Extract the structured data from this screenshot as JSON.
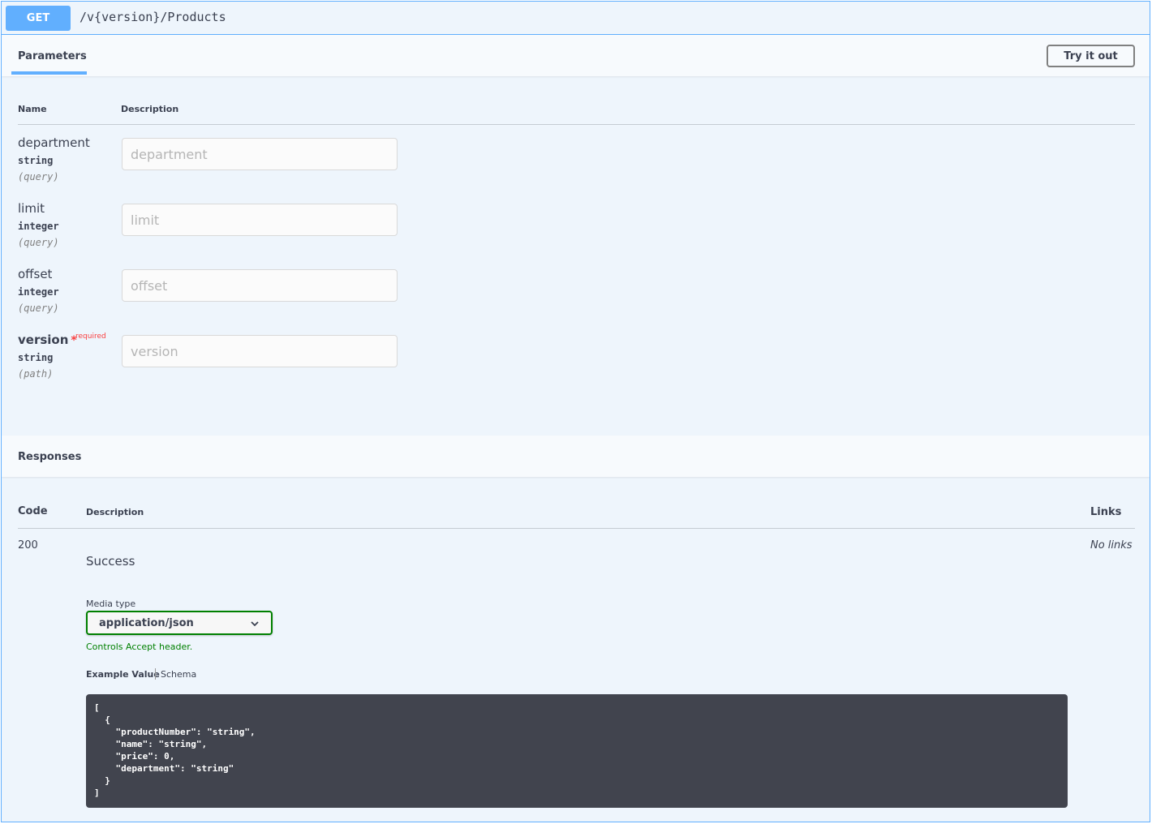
{
  "operation": {
    "method": "GET",
    "path": "/v{version}/Products"
  },
  "parameters": {
    "tab_label": "Parameters",
    "try_button": "Try it out",
    "columns": {
      "name": "Name",
      "description": "Description"
    },
    "required_label": "required",
    "items": [
      {
        "name": "department",
        "type": "string",
        "in": "(query)",
        "placeholder": "department",
        "value": "",
        "required": false
      },
      {
        "name": "limit",
        "type": "integer",
        "in": "(query)",
        "placeholder": "limit",
        "value": "",
        "required": false
      },
      {
        "name": "offset",
        "type": "integer",
        "in": "(query)",
        "placeholder": "offset",
        "value": "",
        "required": false
      },
      {
        "name": "version",
        "type": "string",
        "in": "(path)",
        "placeholder": "version",
        "value": "",
        "required": true
      }
    ]
  },
  "responses": {
    "title": "Responses",
    "columns": {
      "code": "Code",
      "description": "Description",
      "links": "Links"
    },
    "items": [
      {
        "code": "200",
        "description": "Success",
        "links": "No links",
        "media_type_label": "Media type",
        "media_type": "application/json",
        "controls_note": "Controls Accept header.",
        "example_tab": "Example Value",
        "schema_tab": "Schema",
        "example": "[\n  {\n    \"productNumber\": \"string\",\n    \"name\": \"string\",\n    \"price\": 0,\n    \"department\": \"string\"\n  }\n]"
      }
    ]
  },
  "colors": {
    "get_accent": "#61affe",
    "required": "#f93e3e",
    "media_select_border": "#008000",
    "code_background": "#41444e"
  },
  "icons": {
    "select_chevron": "chevron-down-icon"
  }
}
